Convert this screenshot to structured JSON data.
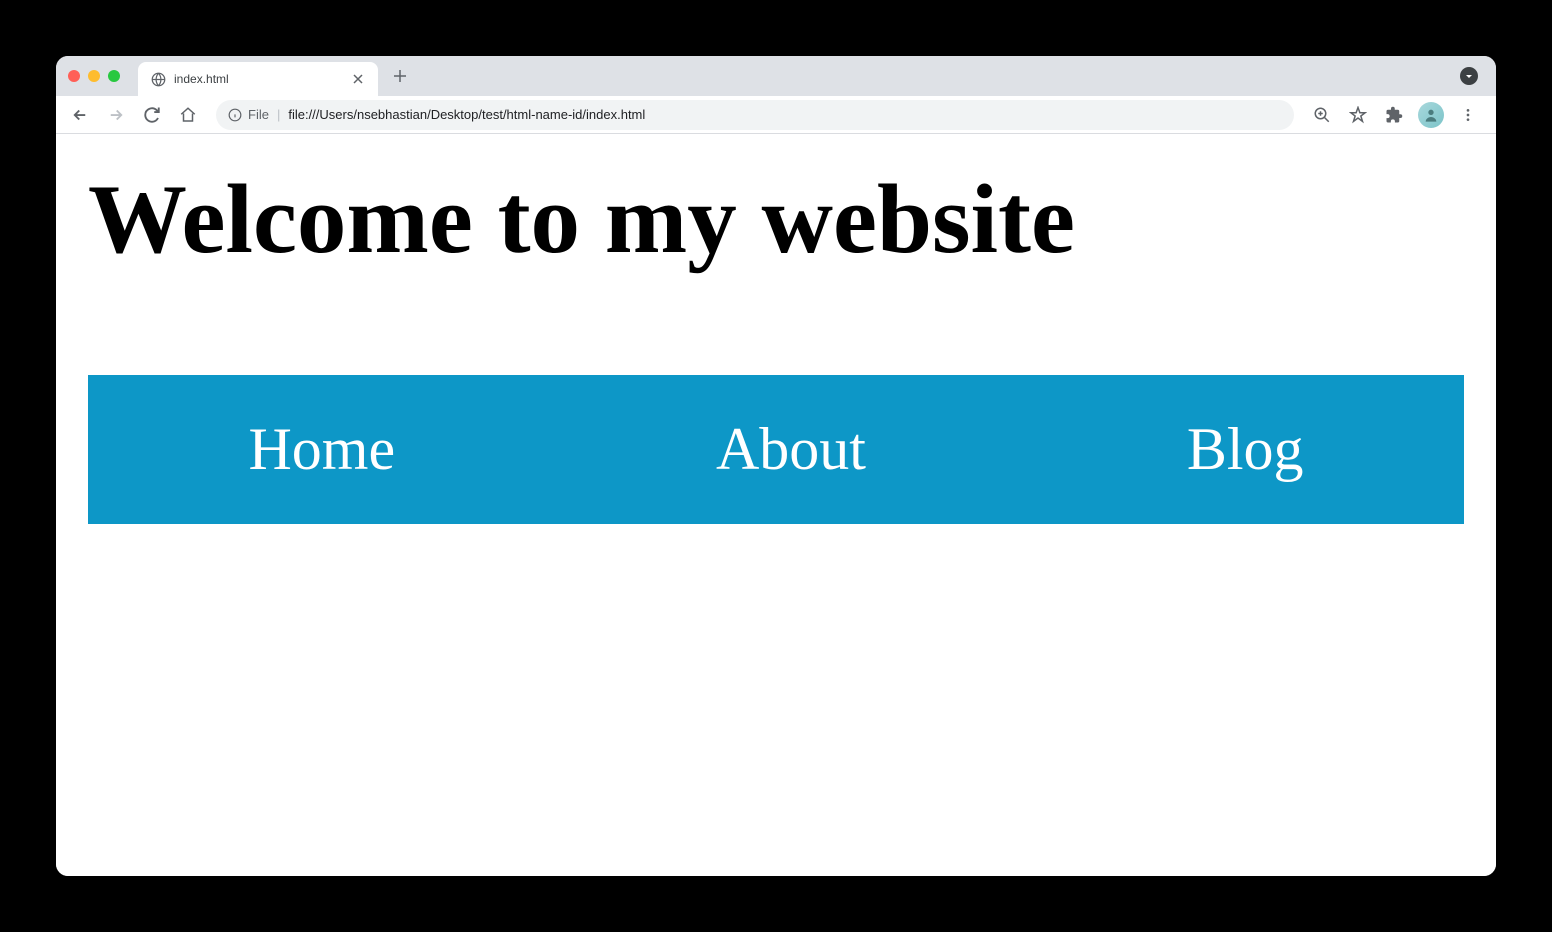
{
  "browser": {
    "tab": {
      "title": "index.html"
    },
    "address": {
      "prefix": "File",
      "url": "file:///Users/nsebhastian/Desktop/test/html-name-id/index.html"
    }
  },
  "page": {
    "heading": "Welcome to my website",
    "nav": {
      "items": [
        {
          "label": "Home"
        },
        {
          "label": "About"
        },
        {
          "label": "Blog"
        }
      ],
      "bg_color": "#0d97c7"
    }
  }
}
